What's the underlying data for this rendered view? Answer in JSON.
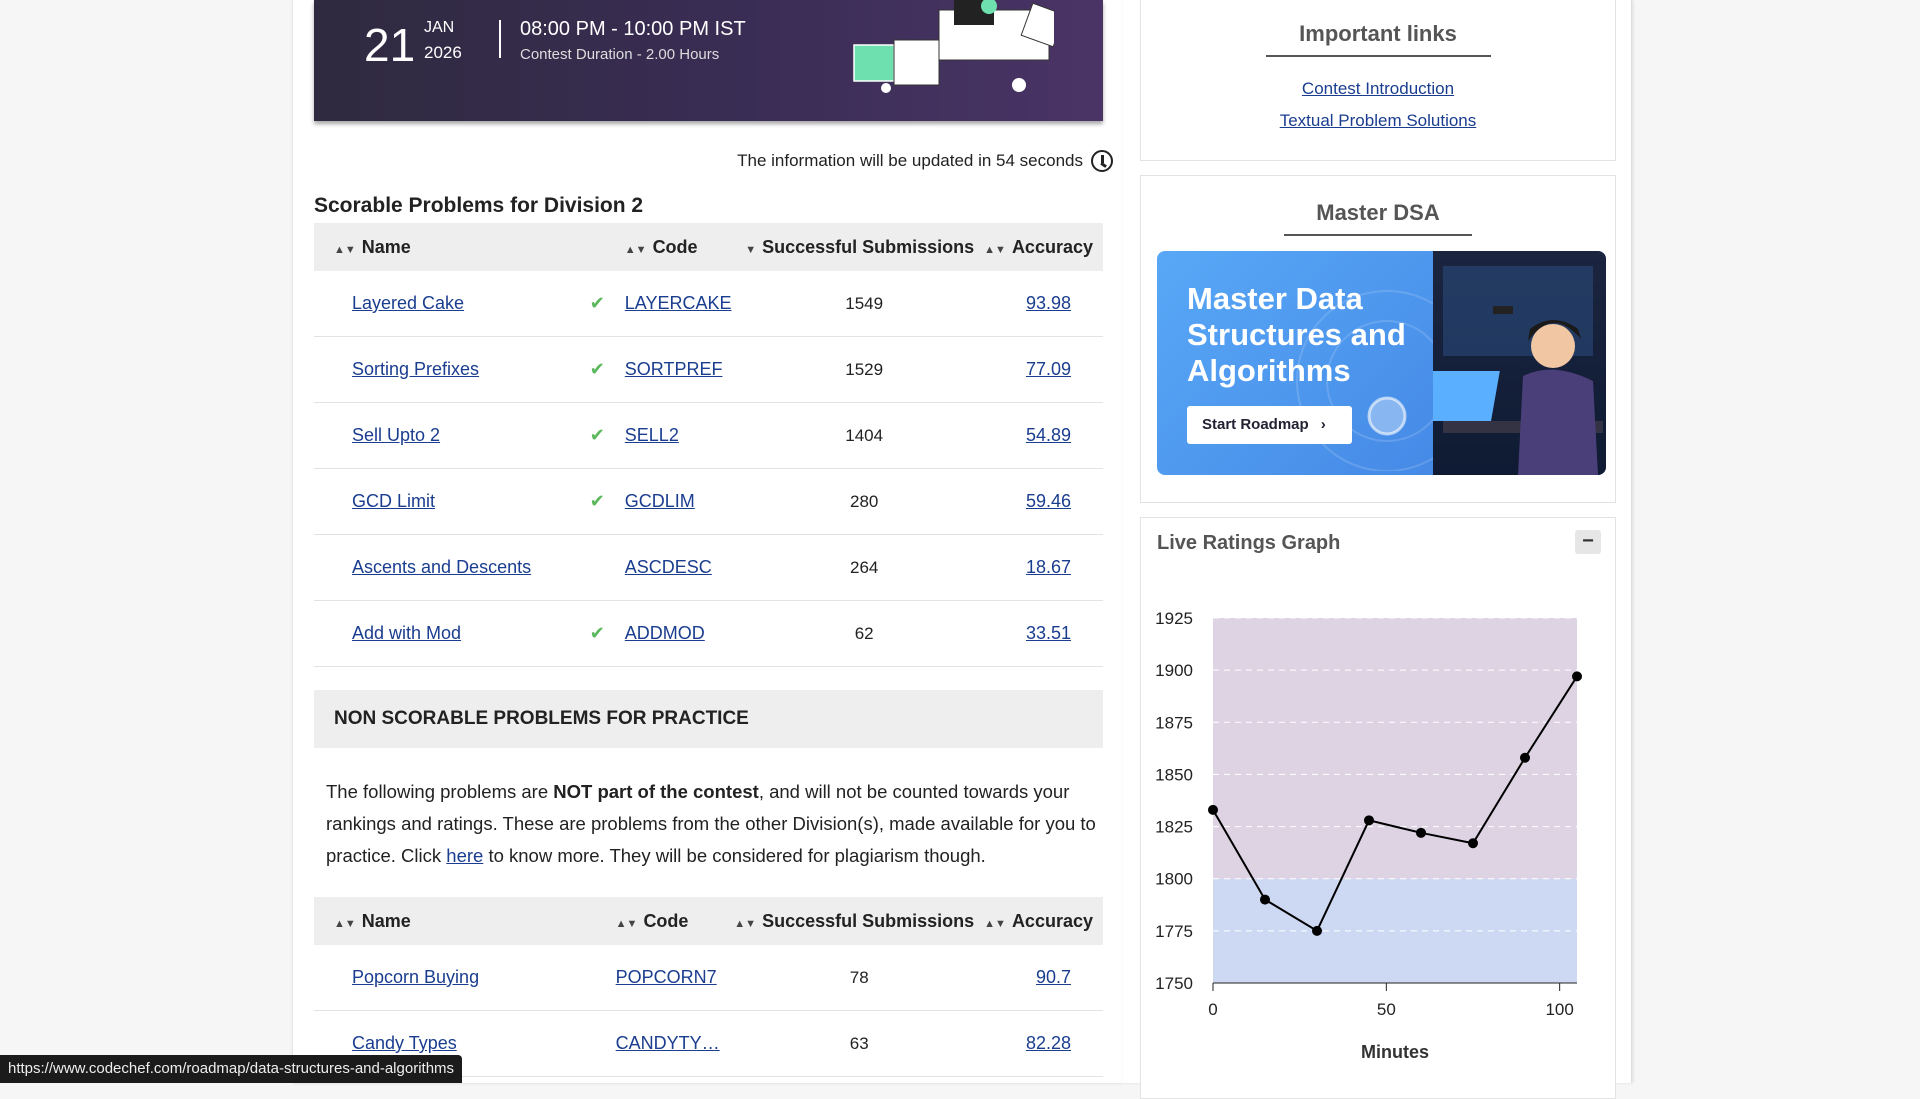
{
  "banner": {
    "day": "21",
    "month": "JAN",
    "year": "2026",
    "time": "08:00 PM - 10:00 PM IST",
    "duration": "Contest Duration - 2.00 Hours"
  },
  "update_notice": "The information will be updated in 54 seconds",
  "scorable": {
    "title": "Scorable Problems for Division 2",
    "headers": {
      "name": "Name",
      "code": "Code",
      "subs": "Successful Submissions",
      "acc": "Accuracy"
    },
    "rows": [
      {
        "name": "Layered Cake",
        "solved": true,
        "code": "LAYERCAKE",
        "subs": "1549",
        "acc": "93.98"
      },
      {
        "name": "Sorting Prefixes",
        "solved": true,
        "code": "SORTPREF",
        "subs": "1529",
        "acc": "77.09"
      },
      {
        "name": "Sell Upto 2",
        "solved": true,
        "code": "SELL2",
        "subs": "1404",
        "acc": "54.89"
      },
      {
        "name": "GCD Limit",
        "solved": true,
        "code": "GCDLIM",
        "subs": "280",
        "acc": "59.46"
      },
      {
        "name": "Ascents and Descents",
        "solved": false,
        "code": "ASCDESC",
        "subs": "264",
        "acc": "18.67"
      },
      {
        "name": "Add with Mod",
        "solved": true,
        "code": "ADDMOD",
        "subs": "62",
        "acc": "33.51"
      }
    ]
  },
  "nonscorable": {
    "title": "NON SCORABLE PROBLEMS FOR PRACTICE",
    "text_1": "The following problems are ",
    "text_bold": "NOT part of the contest",
    "text_2": ", and will not be counted towards your rankings and ratings. These are problems from the other Division(s), made available for you to practice. Click ",
    "text_link": "here",
    "text_3": " to know more. They will be considered for plagiarism though.",
    "headers": {
      "name": "Name",
      "code": "Code",
      "subs": "Successful Submissions",
      "acc": "Accuracy"
    },
    "rows": [
      {
        "name": "Popcorn Buying",
        "code": "POPCORN7",
        "subs": "78",
        "acc": "90.7"
      },
      {
        "name": "Candy Types",
        "code": "CANDYTY…",
        "subs": "63",
        "acc": "82.28"
      }
    ]
  },
  "important_links": {
    "title": "Important links",
    "links": [
      "Contest Introduction",
      "Textual Problem Solutions"
    ]
  },
  "master_dsa": {
    "title": "Master DSA",
    "promo_title": "Master Data Structures and Algorithms",
    "button": "Start Roadmap"
  },
  "ratings_graph": {
    "title": "Live Ratings Graph",
    "collapse_label": "−"
  },
  "chart_data": {
    "type": "line",
    "xlabel": "Minutes",
    "ylabel": "",
    "xlim": [
      0,
      105
    ],
    "ylim": [
      1750,
      1925
    ],
    "xticks": [
      0,
      50,
      100
    ],
    "yticks": [
      1750,
      1775,
      1800,
      1825,
      1850,
      1875,
      1900,
      1925
    ],
    "band_threshold": 1800,
    "colors": {
      "upper_band": "#ddd3e3",
      "lower_band": "#cdd9f3",
      "line": "#000000"
    },
    "x": [
      0,
      15,
      30,
      45,
      60,
      75,
      90,
      105
    ],
    "y": [
      1833,
      1790,
      1775,
      1828,
      1822,
      1817,
      1858,
      1897
    ]
  },
  "status_url": "https://www.codechef.com/roadmap/data-structures-and-algorithms"
}
